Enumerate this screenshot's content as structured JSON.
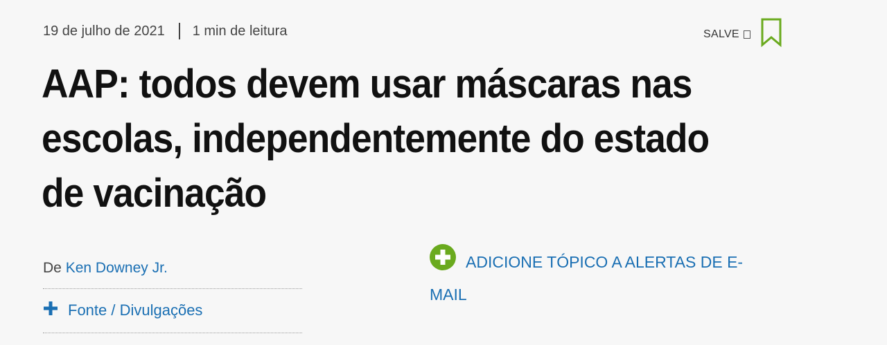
{
  "article": {
    "date": "19 de julho de 2021",
    "read_time": "1 min de leitura",
    "save_label": "SALVE",
    "headline": "AAP: todos devem usar máscaras nas escolas, independentemente do estado de vacinação",
    "byline_prefix": "De",
    "author": "Ken Downey Jr.",
    "disclosures_label": "Fonte / Divulgações",
    "alert_label": "ADICIONE TÓPICO A ALERTAS DE E-MAIL"
  },
  "colors": {
    "link": "#1a6fb3",
    "accent_green": "#6aaa1e",
    "text": "#111111",
    "background": "#f7f7f7"
  },
  "icons": {
    "save": "bookmark-icon",
    "disclosures": "plus-icon",
    "alert": "plus-circle-icon"
  }
}
